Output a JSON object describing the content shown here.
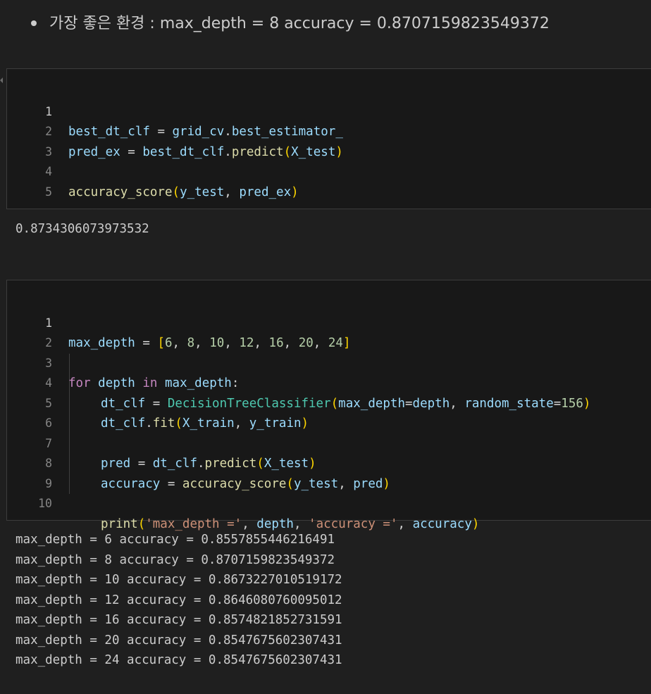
{
  "markdown": {
    "bullet_text": "가장 좋은 환경 : max_depth = 8 accuracy = 0.8707159823549372"
  },
  "cell1": {
    "line_numbers": [
      "1",
      "2",
      "3",
      "4",
      "5"
    ],
    "line1": {
      "a": "best_dt_clf",
      "b": " = ",
      "c": "grid_cv",
      "d": ".",
      "e": "best_estimator_"
    },
    "line2": {
      "a": "pred_ex",
      "b": " = ",
      "c": "best_dt_clf",
      "d": ".",
      "e": "predict",
      "f": "(",
      "g": "X_test",
      "h": ")"
    },
    "line4": {
      "a": "accuracy_score",
      "b": "(",
      "c": "y_test",
      "d": ", ",
      "e": "pred_ex",
      "f": ")"
    },
    "output": "0.8734306073973532"
  },
  "cell2": {
    "line_numbers": [
      "1",
      "2",
      "3",
      "4",
      "5",
      "6",
      "7",
      "8",
      "9",
      "10"
    ],
    "line1": {
      "a": "max_depth",
      "b": " = ",
      "c": "[",
      "n1": "6",
      "n2": "8",
      "n3": "10",
      "n4": "12",
      "n5": "16",
      "n6": "20",
      "n7": "24",
      "sep": ", ",
      "d": "]"
    },
    "line3": {
      "a": "for",
      "b": " ",
      "c": "depth",
      "d": " ",
      "e": "in",
      "f": " ",
      "g": "max_depth",
      "h": ":"
    },
    "line4": {
      "a": "dt_clf",
      "b": " = ",
      "c": "DecisionTreeClassifier",
      "d": "(",
      "e": "max_depth",
      "f": "=",
      "g": "depth",
      "h": ", ",
      "i": "random_state",
      "j": "=",
      "k": "156",
      "l": ")"
    },
    "line5": {
      "a": "dt_clf",
      "b": ".",
      "c": "fit",
      "d": "(",
      "e": "X_train",
      "f": ", ",
      "g": "y_train",
      "h": ")"
    },
    "line7": {
      "a": "pred",
      "b": " = ",
      "c": "dt_clf",
      "d": ".",
      "e": "predict",
      "f": "(",
      "g": "X_test",
      "h": ")"
    },
    "line8": {
      "a": "accuracy",
      "b": " = ",
      "c": "accuracy_score",
      "d": "(",
      "e": "y_test",
      "f": ", ",
      "g": "pred",
      "h": ")"
    },
    "line10": {
      "a": "print",
      "b": "(",
      "c": "'max_depth ='",
      "d": ", ",
      "e": "depth",
      "f": ", ",
      "g": "'accuracy ='",
      "h": ", ",
      "i": "accuracy",
      "j": ")"
    },
    "output": [
      "max_depth = 6 accuracy = 0.8557855446216491",
      "max_depth = 8 accuracy = 0.8707159823549372",
      "max_depth = 10 accuracy = 0.8673227010519172",
      "max_depth = 12 accuracy = 0.8646080760095012",
      "max_depth = 16 accuracy = 0.8574821852731591",
      "max_depth = 20 accuracy = 0.8547675602307431",
      "max_depth = 24 accuracy = 0.8547675602307431"
    ]
  },
  "colors": {
    "background": "#1f1f1f",
    "cell_background": "#181818",
    "keyword": "#c586c0",
    "variable": "#9cdcfe",
    "function": "#dcdcaa",
    "class": "#4ec9b0",
    "number": "#b5cea8",
    "string": "#ce9178"
  }
}
